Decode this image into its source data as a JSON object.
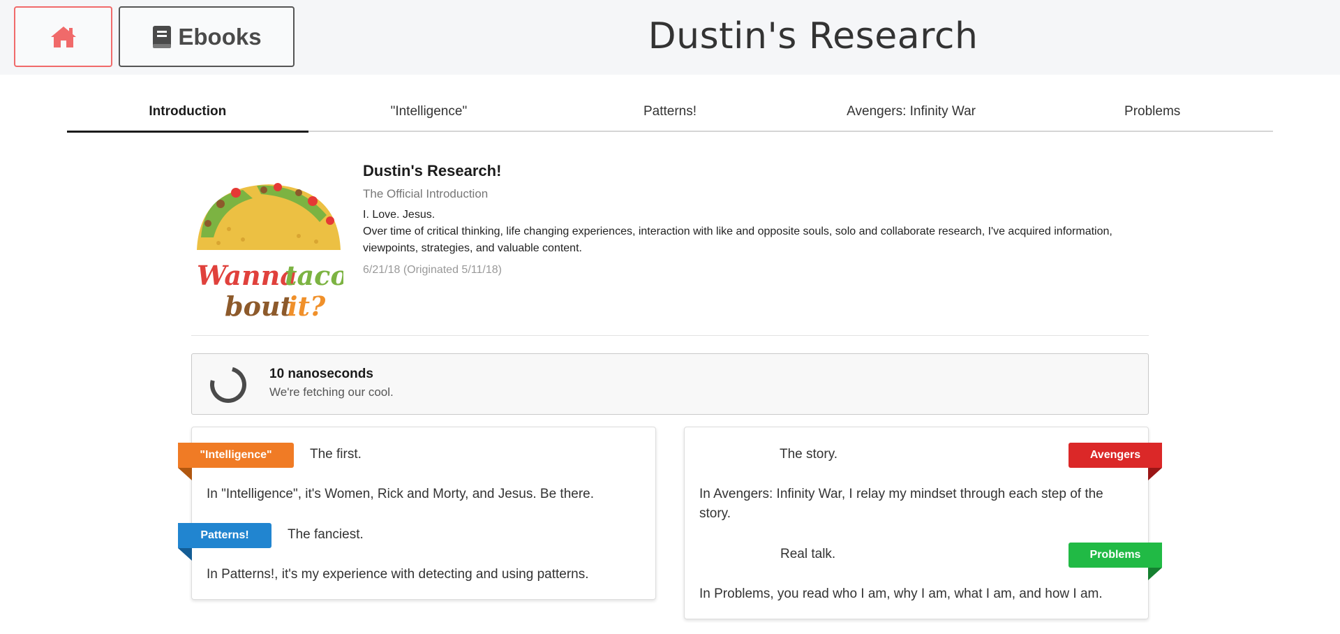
{
  "header": {
    "site_title": "Dustin's Research",
    "ebooks_label": "Ebooks",
    "colors": {
      "home_accent": "#f06a6a",
      "ebooks_border": "#555555"
    }
  },
  "tabs": [
    {
      "label": "Introduction",
      "active": true
    },
    {
      "label": "\"Intelligence\""
    },
    {
      "label": "Patterns!"
    },
    {
      "label": "Avengers: Infinity War"
    },
    {
      "label": "Problems"
    }
  ],
  "intro": {
    "logo_line1a": "Wanna",
    "logo_line1b": "taco",
    "logo_line2a": "bout",
    "logo_line2b": "it?",
    "heading": "Dustin's Research!",
    "subheading": "The Official Introduction",
    "body_line1": "I. Love. Jesus.",
    "body_line2": "Over time of critical thinking, life changing experiences, interaction with like and opposite souls, solo and collaborate research, I've acquired information, viewpoints, strategies, and valuable content.",
    "date": "6/21/18 (Originated 5/11/18)"
  },
  "loader": {
    "title": "10 nanoseconds",
    "subtitle": "We're fetching our cool."
  },
  "cards": {
    "intelligence": {
      "ribbon": "\"Intelligence\"",
      "heading": "The first.",
      "text": "In \"Intelligence\", it's Women, Rick and Morty, and Jesus. Be there.",
      "color": "#f07b25"
    },
    "patterns": {
      "ribbon": "Patterns!",
      "heading": "The fanciest.",
      "text": "In Patterns!, it's my experience with detecting and using patterns.",
      "color": "#2185d0"
    },
    "avengers": {
      "ribbon": "Avengers",
      "heading": "The story.",
      "text": "In Avengers: Infinity War, I relay my mindset through each step of the story.",
      "color": "#db2828"
    },
    "problems": {
      "ribbon": "Problems",
      "heading": "Real talk.",
      "text": "In Problems, you read who I am, why I am, what I am, and how I am.",
      "color": "#21ba45"
    }
  }
}
